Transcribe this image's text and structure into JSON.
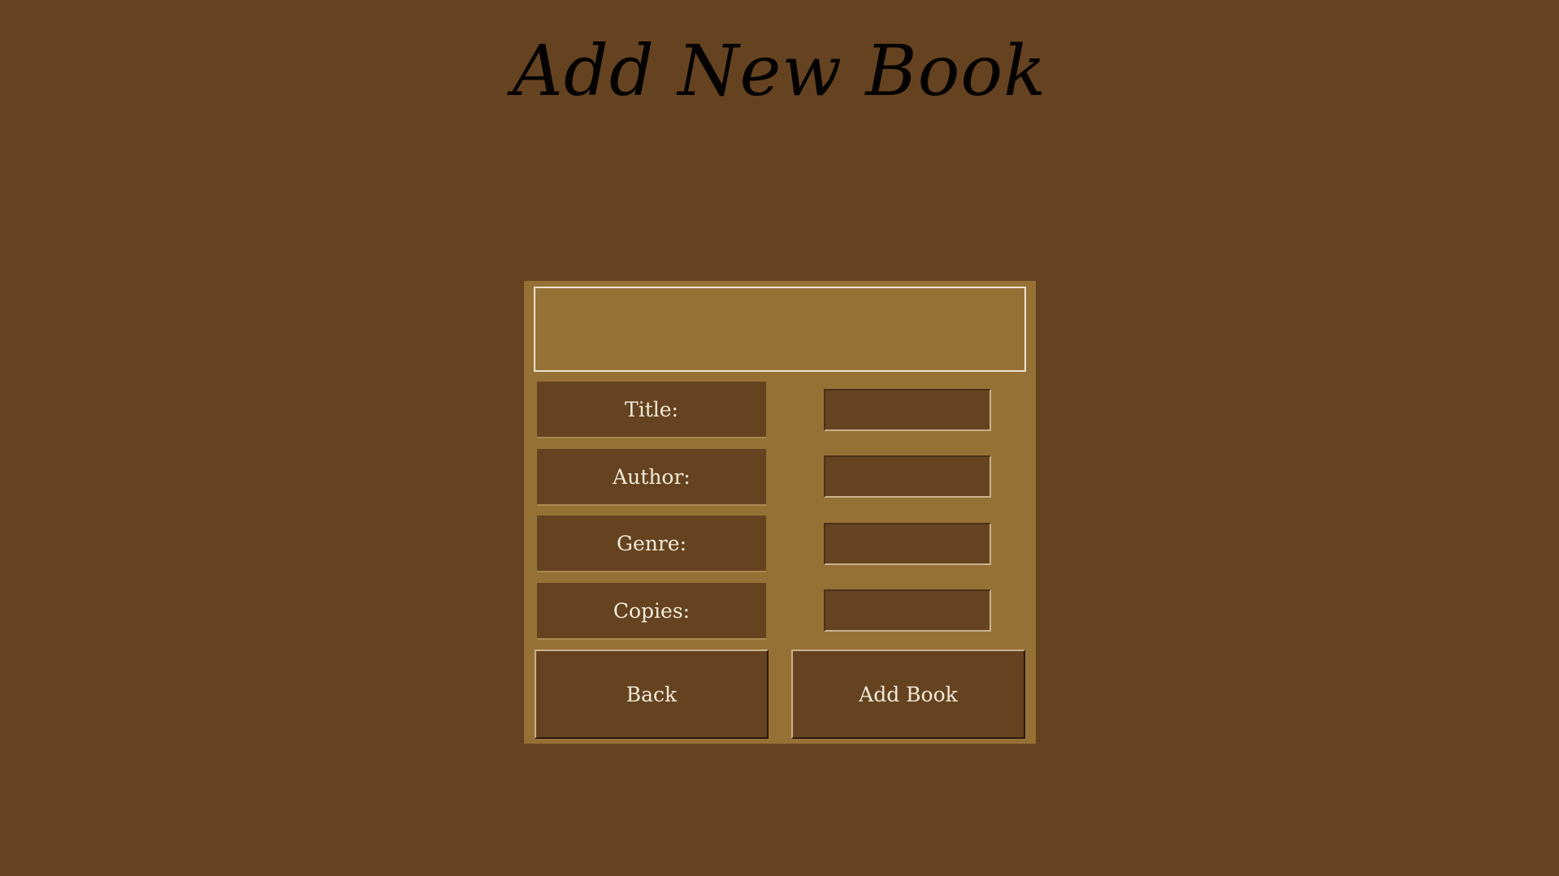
{
  "page": {
    "title": "Add New Book"
  },
  "form": {
    "message": "",
    "fields": [
      {
        "label": "Title:",
        "value": ""
      },
      {
        "label": "Author:",
        "value": ""
      },
      {
        "label": "Genre:",
        "value": ""
      },
      {
        "label": "Copies:",
        "value": ""
      }
    ],
    "buttons": {
      "back_label": "Back",
      "add_label": "Add Book"
    }
  },
  "colors": {
    "background": "#654321",
    "panel": "#967136",
    "label_bg": "#654321",
    "text": "#f3ead9",
    "title_text": "#050302"
  }
}
